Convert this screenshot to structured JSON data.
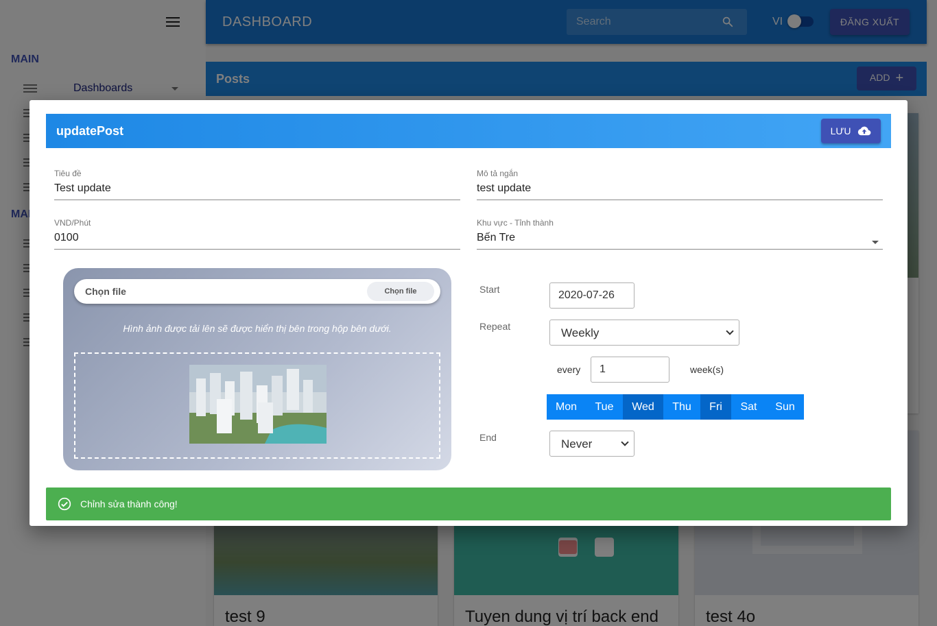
{
  "sidebar": {
    "sections": [
      "MAIN",
      "MAI"
    ],
    "dashboards_label": "Dashboards"
  },
  "topbar": {
    "title": "DASHBOARD",
    "search_placeholder": "Search",
    "language": "VI",
    "logout_label": "ĐĂNG XUẤT"
  },
  "posts": {
    "title": "Posts",
    "add_label": "ADD",
    "cards": [
      "test 9",
      "Tuyen dung vị trí back end",
      "test 4o"
    ]
  },
  "modal": {
    "title": "updatePost",
    "save_label": "LƯU",
    "fields": {
      "title_label": "Tiêu đề",
      "title_value": "Test update",
      "desc_label": "Mô tả ngắn",
      "desc_value": "test update",
      "price_label": "VND/Phút",
      "price_value": "0100",
      "region_label": "Khu vực - Tỉnh thành",
      "region_value": "Bến Tre"
    },
    "upload": {
      "placeholder": "Chọn file",
      "button": "Chọn file",
      "hint": "Hình ảnh được tải lên sẽ được hiển thị bên trong hộp bên dưới."
    },
    "schedule": {
      "start_label": "Start",
      "start_value": "2020-07-26",
      "repeat_label": "Repeat",
      "repeat_value": "Weekly",
      "every_label": "every",
      "every_value": "1",
      "unit_label": "week(s)",
      "days": [
        "Mon",
        "Tue",
        "Wed",
        "Thu",
        "Fri",
        "Sat",
        "Sun"
      ],
      "selected_days": [
        "Wed",
        "Fri"
      ],
      "end_label": "End",
      "end_value": "Never"
    },
    "toast": "Chỉnh sửa thành công!"
  },
  "colors": {
    "primary": "#1976d2",
    "accent": "#3f51b5",
    "success": "#4caf50",
    "day_button": "#0a84f5",
    "day_selected": "#0466c8"
  }
}
